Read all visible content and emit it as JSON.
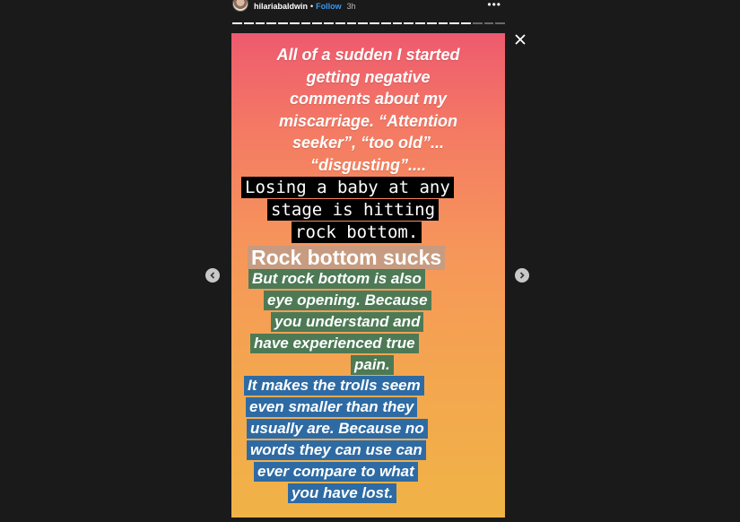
{
  "header": {
    "username": "hilariabaldwin",
    "separator": "•",
    "follow_label": "Follow",
    "time": "3h",
    "more_icon": "more-dots-icon"
  },
  "progress": {
    "total_segments": 24,
    "seen_segments": 21
  },
  "story": {
    "intro_lines": [
      "All of a sudden I started",
      "getting negative",
      "comments about my",
      "miscarriage. “Attention",
      "seeker”, “too old”...",
      "“disgusting”...."
    ],
    "mono_lines": [
      "Losing a baby at any",
      "stage is hitting",
      "rock bottom."
    ],
    "title": "Rock bottom sucks",
    "green_lines": [
      "But rock bottom is also",
      "eye opening. Because",
      "you understand and",
      "have experienced true",
      "pain."
    ],
    "blue_lines": [
      "It makes the trolls seem",
      "even smaller than they",
      "usually are. Because no",
      "words they can use can",
      "ever compare to what",
      "you have lost."
    ]
  },
  "icons": {
    "prev": "chevron-left-icon",
    "next": "chevron-right-icon",
    "close": "close-icon"
  }
}
